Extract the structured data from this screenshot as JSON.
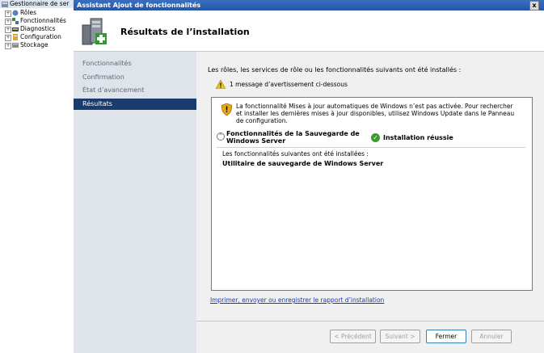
{
  "tree": {
    "root_label": "Gestionnaire de ser",
    "items": [
      {
        "label": "Rôles",
        "icon": "roles-icon"
      },
      {
        "label": "Fonctionnalités",
        "icon": "features-icon"
      },
      {
        "label": "Diagnostics",
        "icon": "diagnostics-icon"
      },
      {
        "label": "Configuration",
        "icon": "configuration-icon"
      },
      {
        "label": "Stockage",
        "icon": "storage-icon"
      }
    ]
  },
  "window": {
    "title": "Assistant Ajout de fonctionnalités",
    "close": "x"
  },
  "header": {
    "title": "Résultats de l’installation"
  },
  "nav": {
    "steps": [
      {
        "label": "Fonctionnalités",
        "active": false
      },
      {
        "label": "Confirmation",
        "active": false
      },
      {
        "label": "État d’avancement",
        "active": false
      },
      {
        "label": "Résultats",
        "active": true
      }
    ]
  },
  "content": {
    "intro": "Les rôles, les services de rôle ou les fonctionnalités suivants ont été installés :",
    "warning_summary": "1 message d’avertissement ci-dessous",
    "message": "La fonctionnalité Mises à jour automatiques de Windows n’est pas activée. Pour rechercher et installer les dernières mises à jour disponibles, utilisez Windows Update dans le Panneau de configuration.",
    "feature_name": "Fonctionnalités de la Sauvegarde de Windows Server",
    "status": "Installation réussie",
    "installed_label": "Les fonctionnalités suivantes ont été installées :",
    "installed_item": "Utilitaire de sauvegarde de Windows Server",
    "report_link": "Imprimer, envoyer ou enregistrer le rapport d’installation"
  },
  "buttons": {
    "previous": "< Précédent",
    "next": "Suivant >",
    "close": "Fermer",
    "cancel": "Annuler"
  },
  "colors": {
    "accent": "#1a3b6e",
    "titlebar": "#2e63b3",
    "success": "#3a9a2c",
    "link": "#1a3caf"
  }
}
